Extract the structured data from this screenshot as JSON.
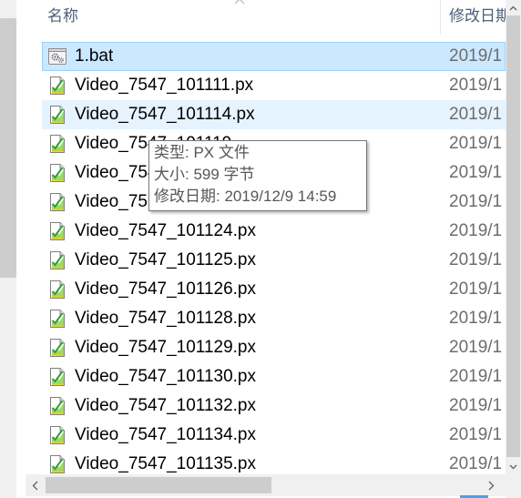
{
  "header": {
    "name_label": "名称",
    "date_label": "修改日期"
  },
  "colors": {
    "selected_bg": "#cce8ff",
    "selected_border": "#99d1ff",
    "hover_bg": "#e5f3ff",
    "header_text": "#4c607a",
    "date_text": "#6d6d6d",
    "scroll_thumb": "#cdcdcd",
    "scroll_track": "#f0f0f0",
    "accent": "#4f9ee8"
  },
  "files": [
    {
      "name": "1.bat",
      "date": "2019/1",
      "icon": "bat-file-icon",
      "state": "selected"
    },
    {
      "name": "Video_7547_101111.px",
      "date": "2019/1",
      "icon": "px-file-icon",
      "state": ""
    },
    {
      "name": "Video_7547_101114.px",
      "date": "2019/1",
      "icon": "px-file-icon",
      "state": "hover"
    },
    {
      "name": "Video_7547_101119",
      "date": "2019/1",
      "icon": "px-file-icon",
      "state": ""
    },
    {
      "name": "Video_754",
      "date": "2019/1",
      "icon": "px-file-icon",
      "state": ""
    },
    {
      "name": "Video_75",
      "date": "2019/1",
      "icon": "px-file-icon",
      "state": ""
    },
    {
      "name": "Video_7547_101124.px",
      "date": "2019/1",
      "icon": "px-file-icon",
      "state": ""
    },
    {
      "name": "Video_7547_101125.px",
      "date": "2019/1",
      "icon": "px-file-icon",
      "state": ""
    },
    {
      "name": "Video_7547_101126.px",
      "date": "2019/1",
      "icon": "px-file-icon",
      "state": ""
    },
    {
      "name": "Video_7547_101128.px",
      "date": "2019/1",
      "icon": "px-file-icon",
      "state": ""
    },
    {
      "name": "Video_7547_101129.px",
      "date": "2019/1",
      "icon": "px-file-icon",
      "state": ""
    },
    {
      "name": "Video_7547_101130.px",
      "date": "2019/1",
      "icon": "px-file-icon",
      "state": ""
    },
    {
      "name": "Video_7547_101132.px",
      "date": "2019/1",
      "icon": "px-file-icon",
      "state": ""
    },
    {
      "name": "Video_7547_101134.px",
      "date": "2019/1",
      "icon": "px-file-icon",
      "state": ""
    },
    {
      "name": "Video_7547_101135.px",
      "date": "2019/1",
      "icon": "px-file-icon",
      "state": ""
    }
  ],
  "tooltip": {
    "lines": [
      "类型: PX 文件",
      "大小: 599 字节",
      "修改日期: 2019/12/9 14:59"
    ]
  },
  "icons": {
    "sort": "chevron-up-icon",
    "scroll_up": "chevron-up-icon",
    "scroll_down": "chevron-down-icon",
    "scroll_left": "chevron-left-icon",
    "scroll_right": "chevron-right-icon"
  }
}
